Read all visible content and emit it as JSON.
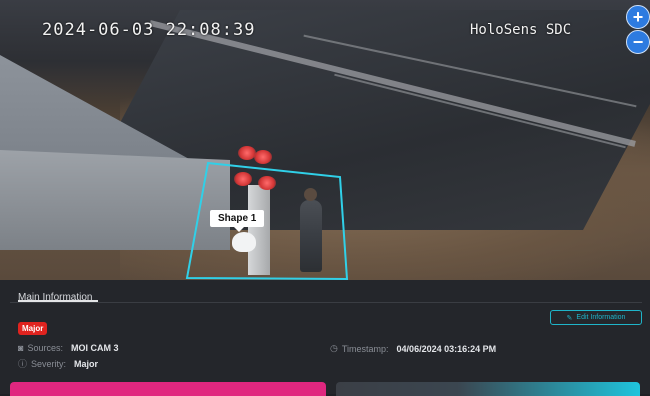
{
  "video": {
    "timestamp_overlay": "2024-06-03  22:08:39",
    "brand_overlay": "HoloSens SDC",
    "zoom_in_label": "+",
    "zoom_out_label": "−",
    "shape_label": "Shape 1"
  },
  "panel": {
    "tab_label": "Main Information",
    "severity_badge": "Major",
    "edit_button_label": "Edit Information",
    "sources_label": "Sources:",
    "sources_value": "MOI CAM 3",
    "severity_label": "Severity:",
    "severity_value": "Major",
    "timestamp_label": "Timestamp:",
    "timestamp_value": "04/06/2024 03:16:24 PM"
  },
  "colors": {
    "accent_cyan": "#1fb4c9",
    "badge_red": "#e0231f",
    "action_pink": "#e0277f",
    "zoom_blue": "#2d7be0"
  },
  "icons": {
    "edit": "pencil-icon",
    "sources": "camera-icon",
    "severity": "info-icon",
    "timestamp": "clock-icon"
  }
}
